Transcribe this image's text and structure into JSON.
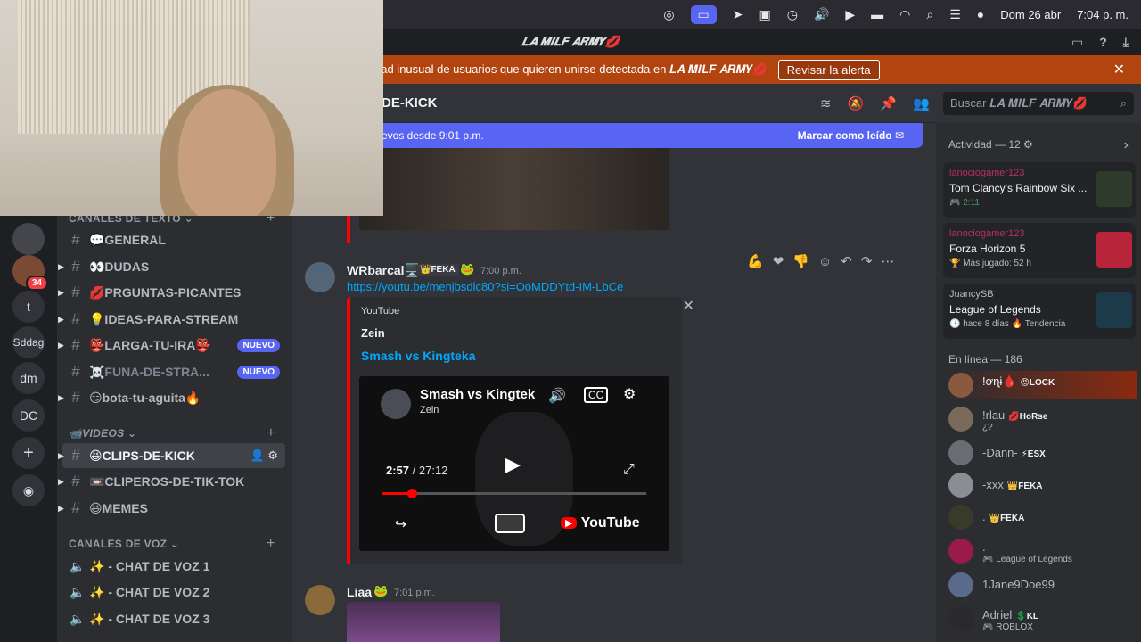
{
  "menubar": {
    "date": "Dom 26 abr",
    "time": "7:04 p. m."
  },
  "titlebar": {
    "title": "𝑳𝑨 𝑴𝑰𝑳𝑭 𝑨𝑹𝑴𝒀💋"
  },
  "alert": {
    "text": "dad inusual de usuarios que quieren unirse detectada en 𝑳𝑨 𝑴𝑰𝑳𝑭 𝑨𝑹𝑴𝒀💋",
    "button": "Revisar la alerta"
  },
  "rail": {
    "servers": [
      "t",
      "Sddag",
      "dm",
      "DC"
    ],
    "badge": "34"
  },
  "sidebar": {
    "category_text": "CANALES DE TEXTO",
    "channels": [
      {
        "label": "💬GENERAL"
      },
      {
        "label": "👀DUDAS"
      },
      {
        "label": "💋PRGUNTAS-PICANTES"
      },
      {
        "label": "💡IDEAS-PARA-STREAM"
      },
      {
        "label": "👺LARGA-TU-IRA👺",
        "badge": "NUEVO"
      },
      {
        "label": "☠️FUNA-DE-STRA...",
        "badge": "NUEVO"
      },
      {
        "label": "😏bota-tu-aguita🔥"
      }
    ],
    "category_videos": "📹VIDEOS",
    "video_channels": [
      {
        "label": "😆CLIPS-DE-KICK"
      },
      {
        "label": "📼CLIPEROS-DE-TIK-TOK"
      },
      {
        "label": "😆MEMES"
      }
    ],
    "category_voice": "CANALES DE VOZ",
    "voice_channels": [
      {
        "label": "✨ - CHAT DE VOZ 1"
      },
      {
        "label": "✨ - CHAT DE VOZ 2"
      },
      {
        "label": "✨ - CHAT DE VOZ 3"
      }
    ]
  },
  "main": {
    "channel_name": "DE-KICK",
    "new_messages": "evos desde 9:01 p.m.",
    "mark_read": "Marcar como leído",
    "search_placeholder": "Buscar 𝑳𝑨 𝑴𝑰𝑳𝑭 𝑨𝑹𝑴𝒀💋",
    "messages": [
      {
        "author": "WRbarcal🖥️",
        "tag": "👑FEKA",
        "time": "7:00 p.m.",
        "link": "https://youtu.be/menjbsdlc80?si=OoMDDYtd-IM-LbCe",
        "embed": {
          "provider": "YouTube",
          "author": "Zein",
          "title": "Smash vs Kingteka",
          "video_title": "Smash vs Kingtek",
          "video_sub": "Zein",
          "elapsed": "2:57",
          "total": "/ 27:12",
          "progress": 0.11,
          "yt_label": "YouTube"
        }
      },
      {
        "author": "Liaa",
        "time": "7:01 p.m."
      }
    ]
  },
  "members": {
    "activity_header": "Actividad — 12",
    "activities": [
      {
        "user": "lanociogamer123",
        "game": "Tom Clancy's Rainbow Six ...",
        "meta": "🎮 2:11"
      },
      {
        "user": "lanociogamer123",
        "game": "Forza Horizon 5",
        "meta": "🏆 Más jugado: 52 h"
      },
      {
        "user": "JuancySB",
        "game": "League of Legends",
        "meta": "🕓 hace 8 días  🔥 Tendencia"
      }
    ],
    "online_header": "En línea — 186",
    "online": [
      {
        "name": "!ơɳɨ🩸",
        "badge": "😡LOCK"
      },
      {
        "name": "!rlau",
        "badge": "💋HoRse",
        "sub": "¿?"
      },
      {
        "name": "-Dann-",
        "badge": "⚡ESX"
      },
      {
        "name": "-xxx",
        "badge": "👑FEKA"
      },
      {
        "name": ".",
        "badge": "👑FEKA"
      },
      {
        "name": ".",
        "sub": "🎮 League of Legends"
      },
      {
        "name": "1Jane9Doe99"
      },
      {
        "name": "Adriel",
        "badge": "💲KL",
        "sub": "🎮 ROBLOX"
      }
    ]
  }
}
